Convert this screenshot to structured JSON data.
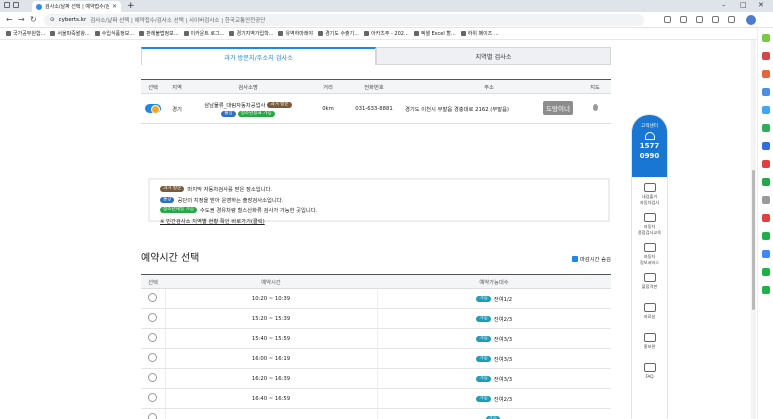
{
  "browser": {
    "tab_title": "검사소/날짜 선택 | 예약접수/검",
    "tab_close": "✕",
    "new_tab": "+",
    "url_host": "cyberts.kr",
    "url_rest": "검사소/날짜 선택 | 예약접수/검사소 선택 | 사이버검사소 | 한국교통안전공단",
    "bookmarks": [
      "국가공무원합...",
      "서울파죽왈왕...",
      "수입식품정보...",
      "판례불법정보...",
      "이카운트 로그...",
      "경기지역가입학...",
      "유역하마래야",
      "경기도 수출기...",
      "아카츠주 - 202...",
      "엑셀 Excel 할...",
      "하위 페이즈 ..."
    ]
  },
  "tabs": [
    "과거 방문지/주소지 검사소",
    "지역별 검사소"
  ],
  "centers_table": {
    "headers": [
      "선택",
      "지역",
      "검사소명",
      "거리",
      "전화번호",
      "주소",
      "지도"
    ],
    "row": {
      "region": "경기",
      "name": "삼남물류_대림자동차공업사",
      "badge_past": "과거 방문",
      "badge_outsourced": "출장",
      "badge_cleaner": "청소년용표 가능",
      "distance": "0km",
      "phone": "031-633-8881",
      "address": "경기도 이천시 부발읍 경충대로 2162 (부발읍)",
      "dobtn": "도망이너"
    }
  },
  "legend": {
    "badge_past": "과거 방문",
    "text_past": "마지막 자동차검사를 받은 장소입니다.",
    "badge_out": "출장",
    "text_out": "공단의 지정을 받아 운영하는 출장검사소입니다.",
    "badge_clean": "청소년해일 가능",
    "text_clean": "수도권 경유차량 힐스산화류 검사가 가능한 곳입니다.",
    "link": "※ 민간검사소 지역별 현황 확인 바로가기(클릭)"
  },
  "section_title": "예약시간 선택",
  "checkbox_label": "마감시간 숨김",
  "time_table": {
    "headers": [
      "선택",
      "예약시간",
      "예약가능대수"
    ],
    "rows": [
      {
        "time": "10:20 ~ 10:39",
        "badge": "가능",
        "rest": "잔여1/2"
      },
      {
        "time": "15:20 ~ 15:39",
        "badge": "가능",
        "rest": "잔여2/3"
      },
      {
        "time": "15:40 ~ 15:59",
        "badge": "가능",
        "rest": "잔여3/3"
      },
      {
        "time": "16:00 ~ 16:19",
        "badge": "가능",
        "rest": "잔여3/3"
      },
      {
        "time": "16:20 ~ 16:39",
        "badge": "가능",
        "rest": "잔여3/3"
      },
      {
        "time": "16:40 ~ 16:59",
        "badge": "가능",
        "rest": "잔여2/3"
      },
      {
        "time": "",
        "badge": "가능",
        "rest": ""
      }
    ]
  },
  "widget": {
    "title": "고객센터",
    "phone": "1577\n0990",
    "phone_a": "1577",
    "phone_b": "0990",
    "items": [
      "내검출기\n자동차검사",
      "자동차\n종합검사교육",
      "자동차\n정보서비스",
      "불합격판",
      "자료실",
      "홍보관",
      "FAQ"
    ]
  },
  "colors": {
    "accent": "#1e88e5",
    "brown": "#7a5a3a",
    "green": "#28a745",
    "widget": "#1976d2"
  }
}
